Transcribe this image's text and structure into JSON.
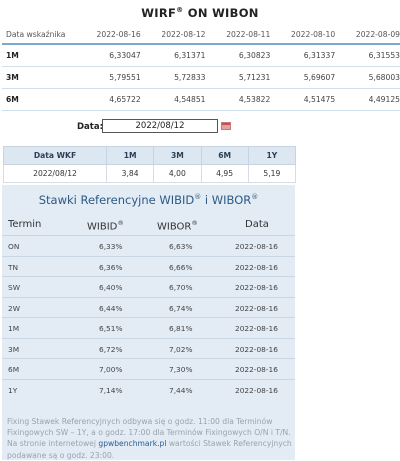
{
  "wirf": {
    "title_main": "WIRF",
    "title_sup": "®",
    "title_suffix": " ON WIBON",
    "header_label": "Data wskaźnika",
    "dates": [
      "2022-08-16",
      "2022-08-12",
      "2022-08-11",
      "2022-08-10",
      "2022-08-09"
    ],
    "rows": [
      {
        "label": "1M",
        "values": [
          "6,33047",
          "6,31371",
          "6,30823",
          "6,31337",
          "6,31553"
        ]
      },
      {
        "label": "3M",
        "values": [
          "5,79551",
          "5,72833",
          "5,71231",
          "5,69607",
          "5,68003"
        ]
      },
      {
        "label": "6M",
        "values": [
          "4,65722",
          "4,54851",
          "4,53822",
          "4,51475",
          "4,49125"
        ]
      }
    ]
  },
  "date_picker": {
    "label": "Data:",
    "value": "2022/08/12"
  },
  "wkf": {
    "headers": [
      "Data WKF",
      "1M",
      "3M",
      "6M",
      "1Y"
    ],
    "row": [
      "2022/08/12",
      "3,84",
      "4,00",
      "4,95",
      "5,19"
    ]
  },
  "ref": {
    "title_a": "Stawki Referencyjne WIBID",
    "title_sup1": "®",
    "title_b": " i WIBOR",
    "title_sup2": "®",
    "col_termin": "Termin",
    "col_wibid": "WIBID",
    "col_wibor": "WIBOR",
    "col_sup": "®",
    "col_data": "Data",
    "rows": [
      {
        "term": "ON",
        "wibid": "6,33%",
        "wibor": "6,63%",
        "date": "2022-08-16"
      },
      {
        "term": "TN",
        "wibid": "6,36%",
        "wibor": "6,66%",
        "date": "2022-08-16"
      },
      {
        "term": "SW",
        "wibid": "6,40%",
        "wibor": "6,70%",
        "date": "2022-08-16"
      },
      {
        "term": "2W",
        "wibid": "6,44%",
        "wibor": "6,74%",
        "date": "2022-08-16"
      },
      {
        "term": "1M",
        "wibid": "6,51%",
        "wibor": "6,81%",
        "date": "2022-08-16"
      },
      {
        "term": "3M",
        "wibid": "6,72%",
        "wibor": "7,02%",
        "date": "2022-08-16"
      },
      {
        "term": "6M",
        "wibid": "7,00%",
        "wibor": "7,30%",
        "date": "2022-08-16"
      },
      {
        "term": "1Y",
        "wibid": "7,14%",
        "wibor": "7,44%",
        "date": "2022-08-16"
      }
    ],
    "note_pre": "Fixing Stawek Referencyjnych odbywa się o godz. 11:00 dla Terminów Fixingowych SW – 1Y, a o godz. 17:00 dla Terminów Fixingowych O/N i T/N. Na stronie internetowej ",
    "note_link": "gpwbenchmark.pl",
    "note_post": " wartości Stawek Referencyjnych podawane są o godz. 23:00."
  }
}
